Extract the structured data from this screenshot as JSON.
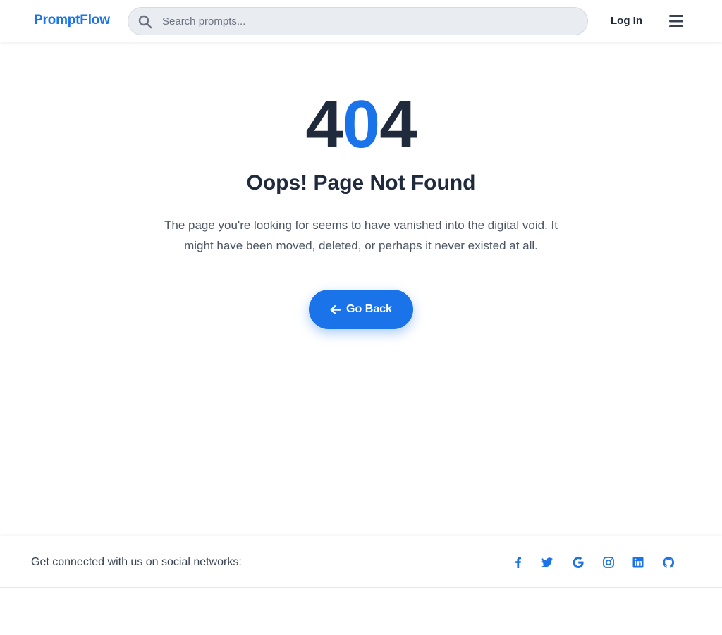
{
  "header": {
    "brand": "PromptFlow",
    "search_placeholder": "Search prompts...",
    "login_label": "Log In"
  },
  "error": {
    "code_left": "4",
    "code_mid": "0",
    "code_right": "4",
    "title": "Oops! Page Not Found",
    "description": "The page you're looking for seems to have vanished into the digital void. It might have been moved, deleted, or perhaps it never existed at all.",
    "back_label": "Go Back"
  },
  "footer": {
    "text": "Get connected with us on social networks:",
    "socials": [
      "facebook-icon",
      "twitter-icon",
      "google-icon",
      "instagram-icon",
      "linkedin-icon",
      "github-icon"
    ]
  },
  "colors": {
    "accent": "#1a73e8",
    "heading": "#1f2a3d",
    "body_text": "#4b5563"
  }
}
